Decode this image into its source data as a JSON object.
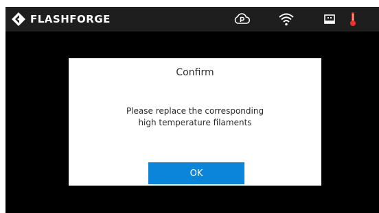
{
  "header": {
    "brand": "FLASHFORGE",
    "status_icons": {
      "cloud": "cloud-print-icon",
      "wifi": "wifi-icon",
      "usb": "usb-icon",
      "temperature": "thermometer-icon"
    }
  },
  "dialog": {
    "title": "Confirm",
    "message_line1": "Please replace the corresponding",
    "message_line2": "high temperature filaments",
    "ok_label": "OK"
  },
  "colors": {
    "screen_background": "#000000",
    "topbar_background": "#1e1e1e",
    "dialog_background": "#ffffff",
    "button_accent": "#0a85d9",
    "thermometer": "#e8342a"
  }
}
